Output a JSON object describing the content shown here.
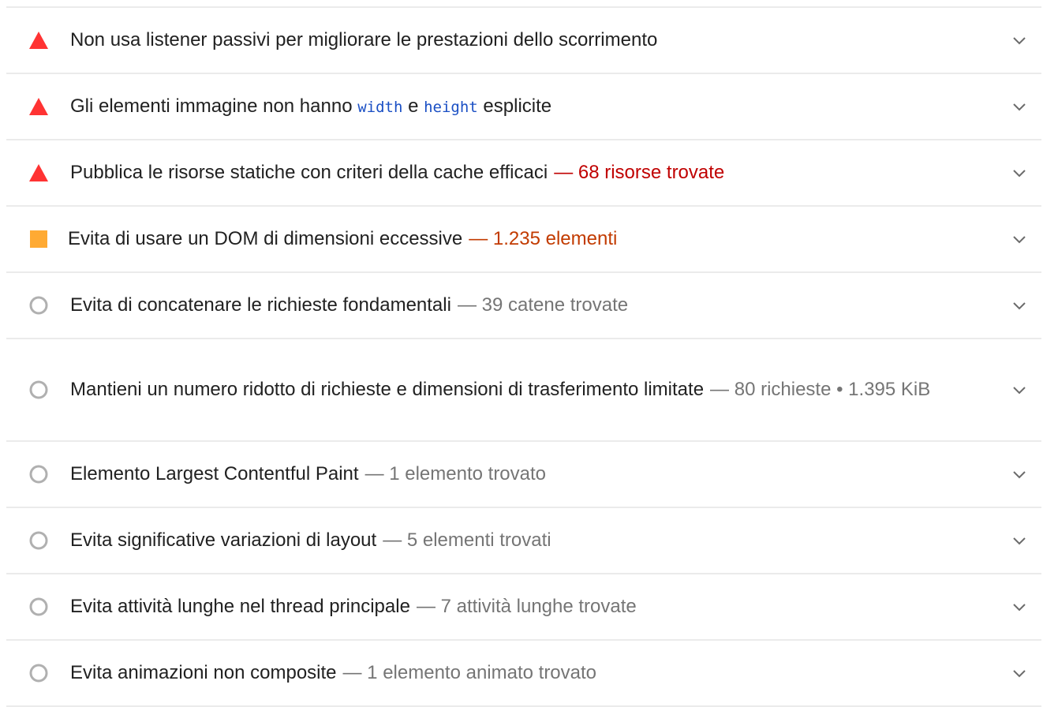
{
  "colors": {
    "fail": "#ff3333",
    "average": "#ffaa33",
    "info": "#b0b0b0",
    "code": "#1a4fc4",
    "divider": "#ebebeb"
  },
  "audits": [
    {
      "status": "fail",
      "title": "Non usa listener passivi per migliorare le prestazioni dello scorrimento",
      "display": ""
    },
    {
      "status": "fail",
      "title_pre": "Gli elementi immagine non hanno ",
      "code1": "width",
      "title_mid": " e ",
      "code2": "height",
      "title_post": " esplicite"
    },
    {
      "status": "fail",
      "title": "Pubblica le risorse statiche con criteri della cache efficaci",
      "display": "— 68 risorse trovate"
    },
    {
      "status": "average",
      "title": "Evita di usare un DOM di dimensioni eccessive",
      "display": "— 1.235 elementi"
    },
    {
      "status": "info",
      "title": "Evita di concatenare le richieste fondamentali",
      "display": "— 39 catene trovate"
    },
    {
      "status": "info",
      "title": "Mantieni un numero ridotto di richieste e dimensioni di trasferimento limitate",
      "display": "— 80 richieste • 1.395 KiB"
    },
    {
      "status": "info",
      "title": "Elemento Largest Contentful Paint",
      "display": "— 1 elemento trovato"
    },
    {
      "status": "info",
      "title": "Evita significative variazioni di layout",
      "display": "— 5 elementi trovati"
    },
    {
      "status": "info",
      "title": "Evita attività lunghe nel thread principale",
      "display": "— 7 attività lunghe trovate"
    },
    {
      "status": "info",
      "title": "Evita animazioni non composite",
      "display": "— 1 elemento animato trovato"
    }
  ]
}
